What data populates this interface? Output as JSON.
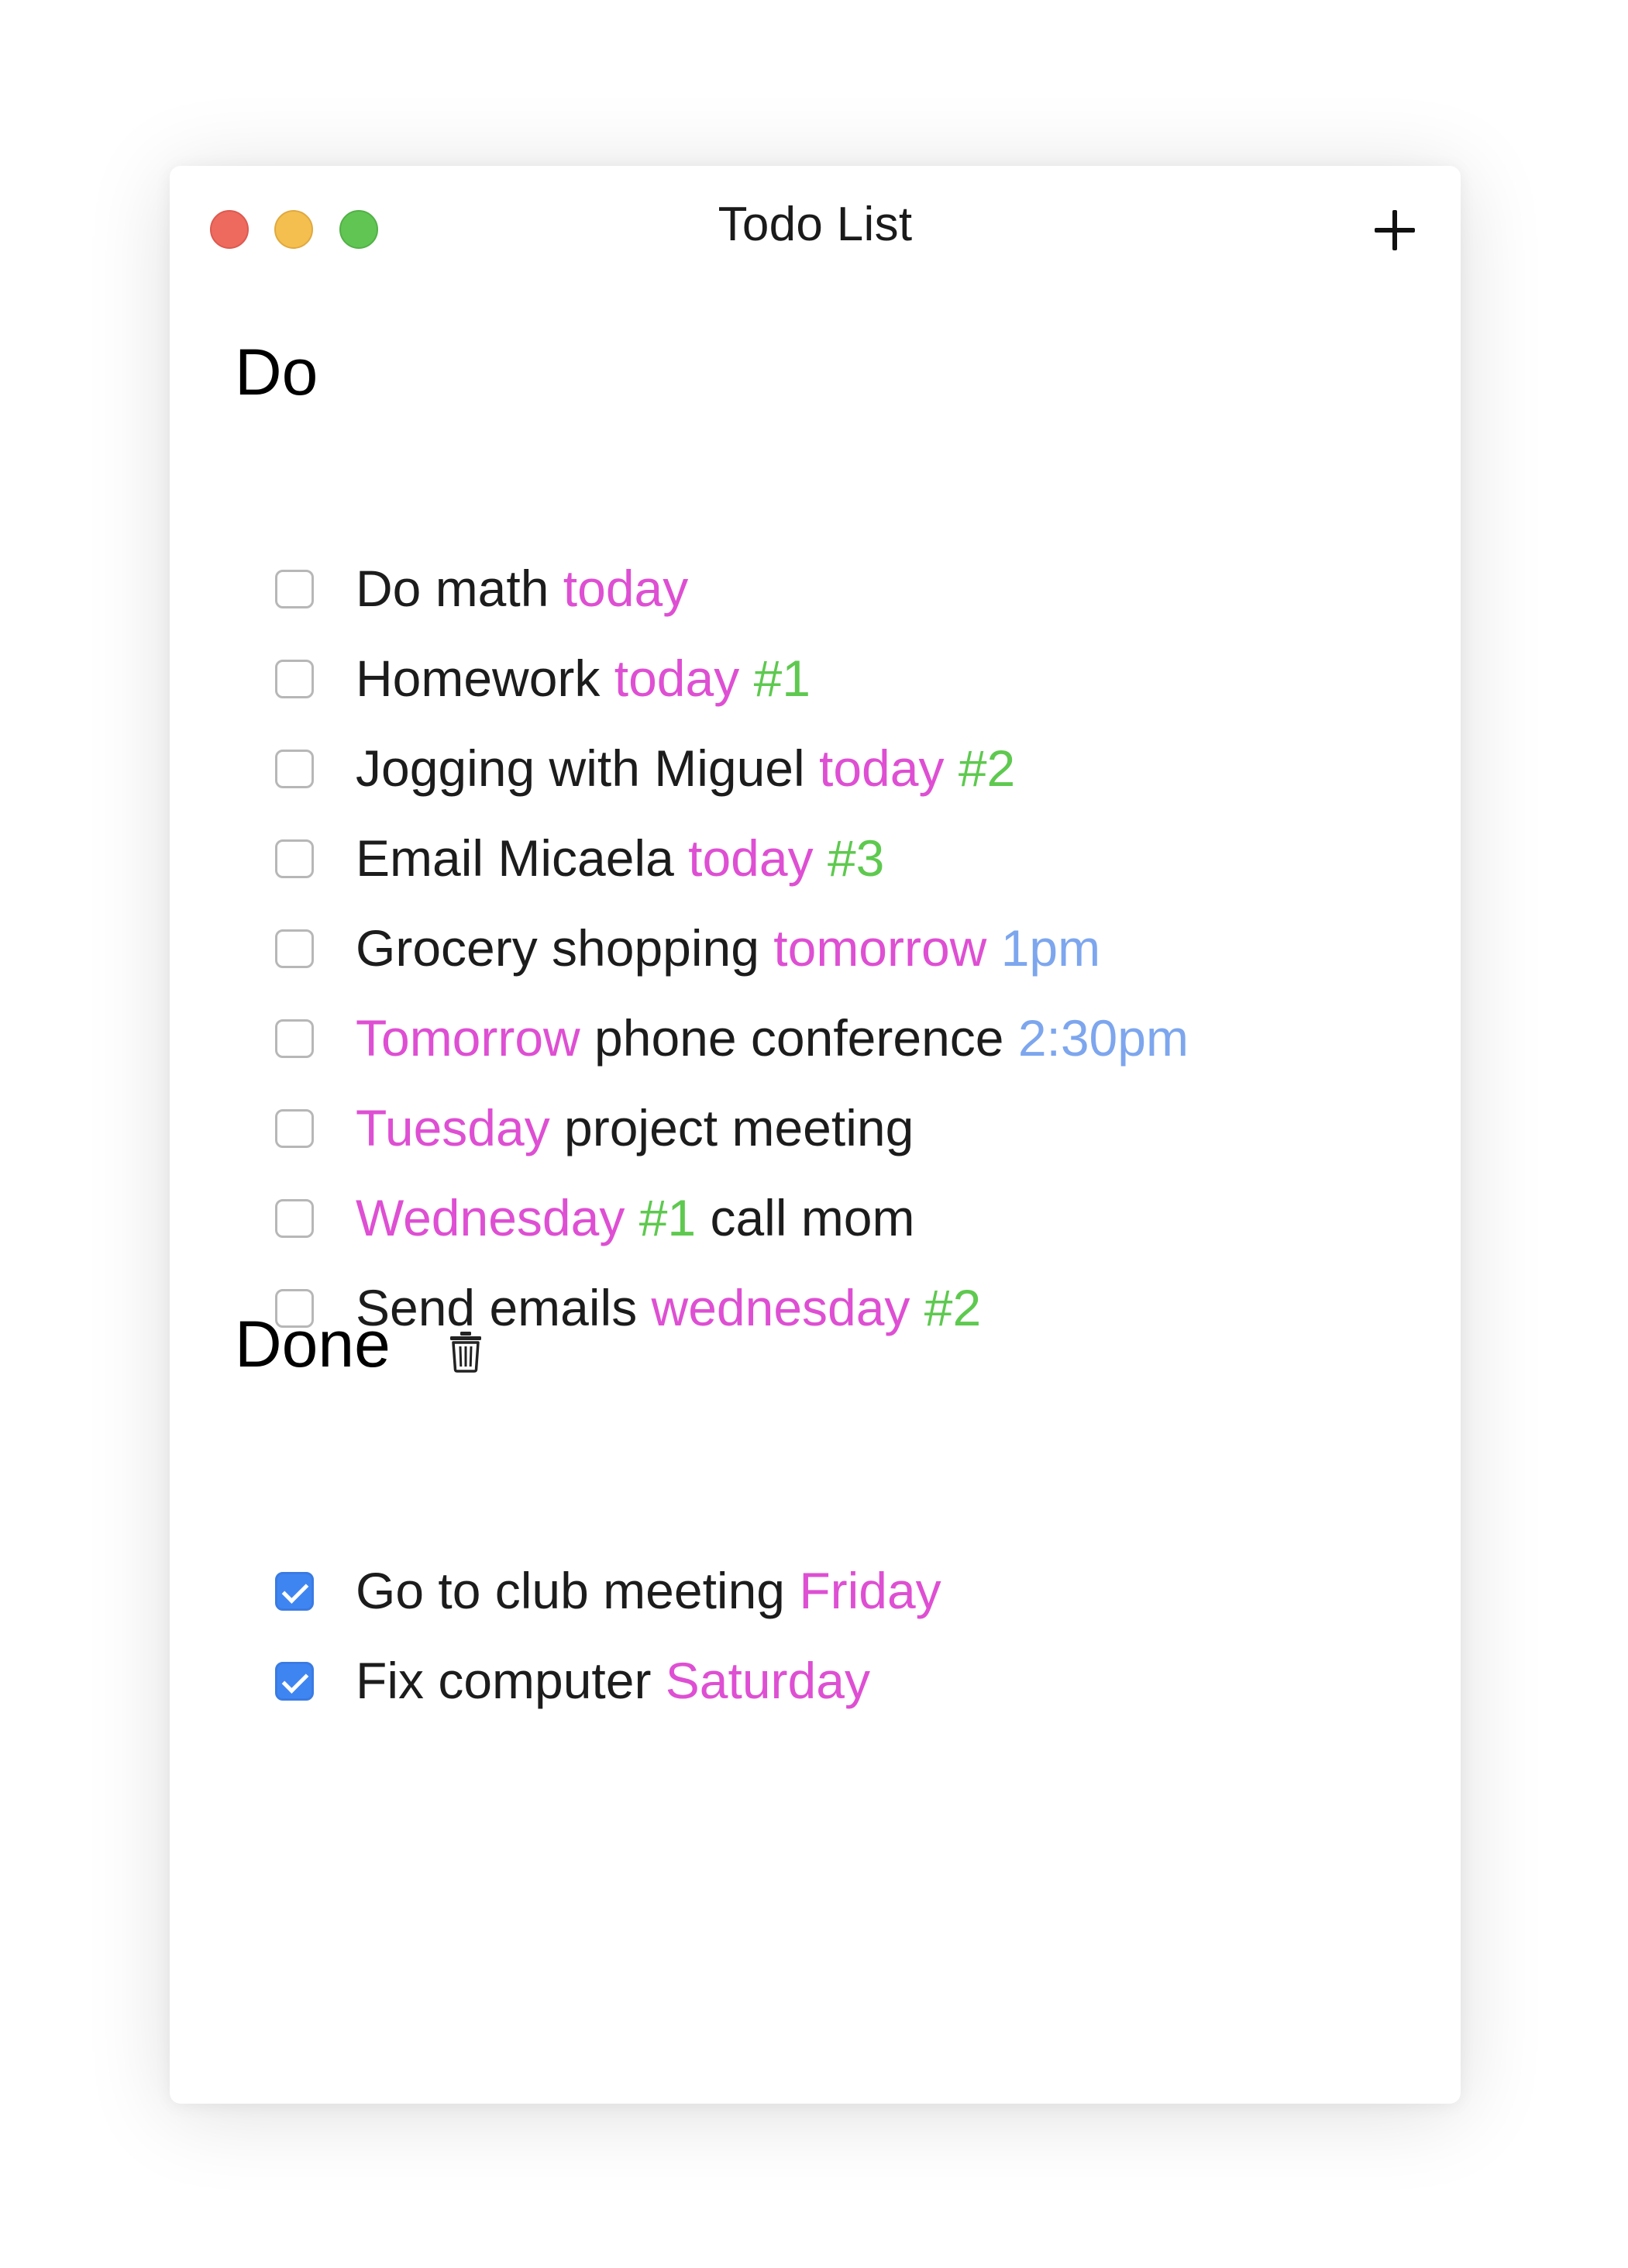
{
  "window": {
    "title": "Todo List",
    "controls": [
      "close",
      "minimize",
      "zoom"
    ],
    "add_icon": "plus-icon"
  },
  "colors": {
    "close": "#ee6a5f",
    "minimize": "#f5bf4f",
    "zoom": "#61c554",
    "date_token": "#de4fd3",
    "priority_token": "#5ec94f",
    "time_token": "#7da6ee",
    "checked": "#3f85f2",
    "text": "#1c1c1c"
  },
  "sections": {
    "do": {
      "title": "Do",
      "items": [
        {
          "checked": false,
          "segments": [
            {
              "text": "Do math ",
              "kind": "text"
            },
            {
              "text": "today",
              "kind": "date"
            }
          ]
        },
        {
          "checked": false,
          "segments": [
            {
              "text": "Homework ",
              "kind": "text"
            },
            {
              "text": "today",
              "kind": "date"
            },
            {
              "text": " ",
              "kind": "text"
            },
            {
              "text": "#1",
              "kind": "priority"
            }
          ]
        },
        {
          "checked": false,
          "segments": [
            {
              "text": "Jogging with Miguel ",
              "kind": "text"
            },
            {
              "text": "today",
              "kind": "date"
            },
            {
              "text": " ",
              "kind": "text"
            },
            {
              "text": "#2",
              "kind": "priority"
            }
          ]
        },
        {
          "checked": false,
          "segments": [
            {
              "text": "Email Micaela ",
              "kind": "text"
            },
            {
              "text": "today",
              "kind": "date"
            },
            {
              "text": " ",
              "kind": "text"
            },
            {
              "text": "#3",
              "kind": "priority"
            }
          ]
        },
        {
          "checked": false,
          "segments": [
            {
              "text": "Grocery shopping ",
              "kind": "text"
            },
            {
              "text": "tomorrow",
              "kind": "date"
            },
            {
              "text": " ",
              "kind": "text"
            },
            {
              "text": "1pm",
              "kind": "time"
            }
          ]
        },
        {
          "checked": false,
          "segments": [
            {
              "text": "Tomorrow",
              "kind": "date"
            },
            {
              "text": " phone conference ",
              "kind": "text"
            },
            {
              "text": "2:30pm",
              "kind": "time"
            }
          ]
        },
        {
          "checked": false,
          "segments": [
            {
              "text": "Tuesday",
              "kind": "date"
            },
            {
              "text": " project meeting",
              "kind": "text"
            }
          ]
        },
        {
          "checked": false,
          "segments": [
            {
              "text": "Wednesday",
              "kind": "date"
            },
            {
              "text": " ",
              "kind": "text"
            },
            {
              "text": "#1",
              "kind": "priority"
            },
            {
              "text": " call mom",
              "kind": "text"
            }
          ]
        },
        {
          "checked": false,
          "segments": [
            {
              "text": "Send emails ",
              "kind": "text"
            },
            {
              "text": "wednesday",
              "kind": "date"
            },
            {
              "text": " ",
              "kind": "text"
            },
            {
              "text": "#2",
              "kind": "priority"
            }
          ]
        }
      ]
    },
    "done": {
      "title": "Done",
      "clear_icon": "trash-icon",
      "items": [
        {
          "checked": true,
          "segments": [
            {
              "text": "Go to club meeting ",
              "kind": "text"
            },
            {
              "text": "Friday",
              "kind": "date"
            }
          ]
        },
        {
          "checked": true,
          "segments": [
            {
              "text": "Fix computer ",
              "kind": "text"
            },
            {
              "text": "Saturday",
              "kind": "date"
            }
          ]
        }
      ]
    }
  }
}
